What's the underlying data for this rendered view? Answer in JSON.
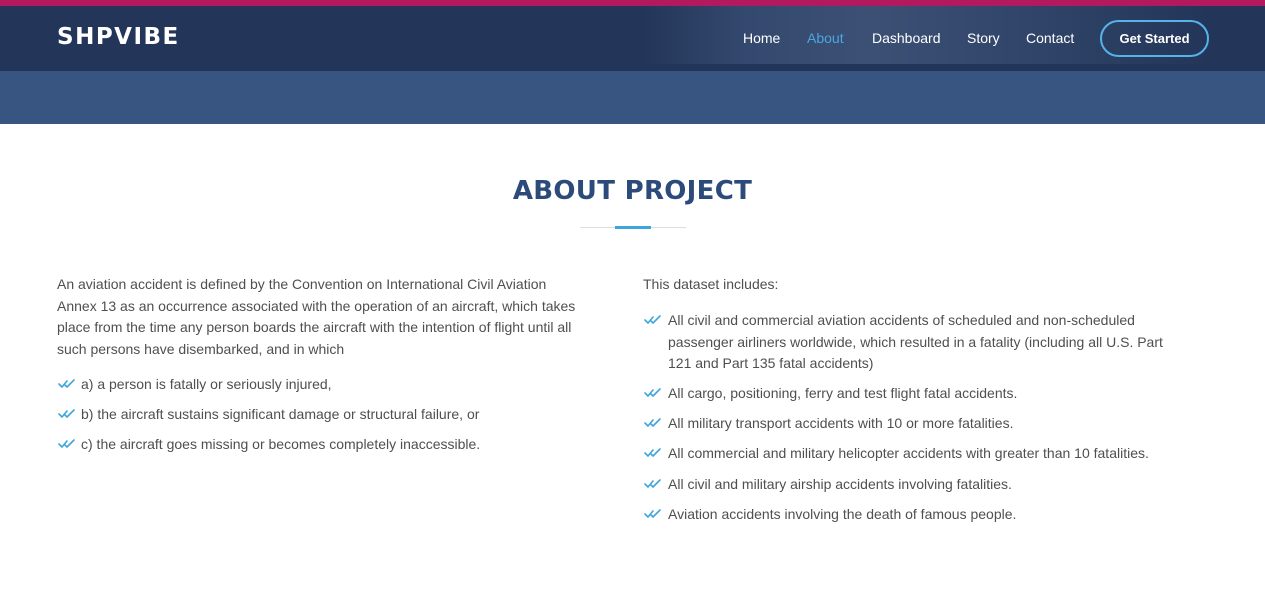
{
  "brand": {
    "logo": "SHPVIBE"
  },
  "nav": {
    "items": [
      {
        "label": "Home",
        "active": false
      },
      {
        "label": "About",
        "active": true
      },
      {
        "label": "Dashboard",
        "active": false
      },
      {
        "label": "Story",
        "active": false
      },
      {
        "label": "Contact",
        "active": false
      }
    ],
    "cta_label": "Get Started"
  },
  "colors": {
    "header_bg": "#233659",
    "band_bg": "#385582",
    "accent": "#3fa5dd",
    "top_strip": "#b3195e",
    "title": "#2c4a7a"
  },
  "section": {
    "title": "ABOUT PROJECT",
    "left": {
      "intro_lines": [
        "An aviation accident is defined by the Convention on International Civil Aviation",
        "Annex 13 as an occurrence associated with the operation of an aircraft, which takes",
        "place from the time any person boards the aircraft with the intention of flight until all",
        "such persons have disembarked, and in which"
      ],
      "items": [
        "a) a person is fatally or seriously injured,",
        "b) the aircraft sustains significant damage or structural failure, or",
        "c) the aircraft goes missing or becomes completely inaccessible."
      ]
    },
    "right": {
      "intro": "This dataset includes:",
      "first_item_lines": [
        "All civil and commercial aviation accidents of scheduled and non-scheduled",
        "passenger airliners worldwide, which resulted in a fatality (including all U.S. Part",
        "121 and Part 135 fatal accidents)"
      ],
      "items": [
        "All cargo, positioning, ferry and test flight fatal accidents.",
        "All military transport accidents with 10 or more fatalities.",
        "All commercial and military helicopter accidents with greater than 10 fatalities.",
        "All civil and military airship accidents involving fatalities.",
        "Aviation accidents involving the death of famous people."
      ]
    }
  },
  "icons": {
    "list_marker": "double-check-icon"
  }
}
